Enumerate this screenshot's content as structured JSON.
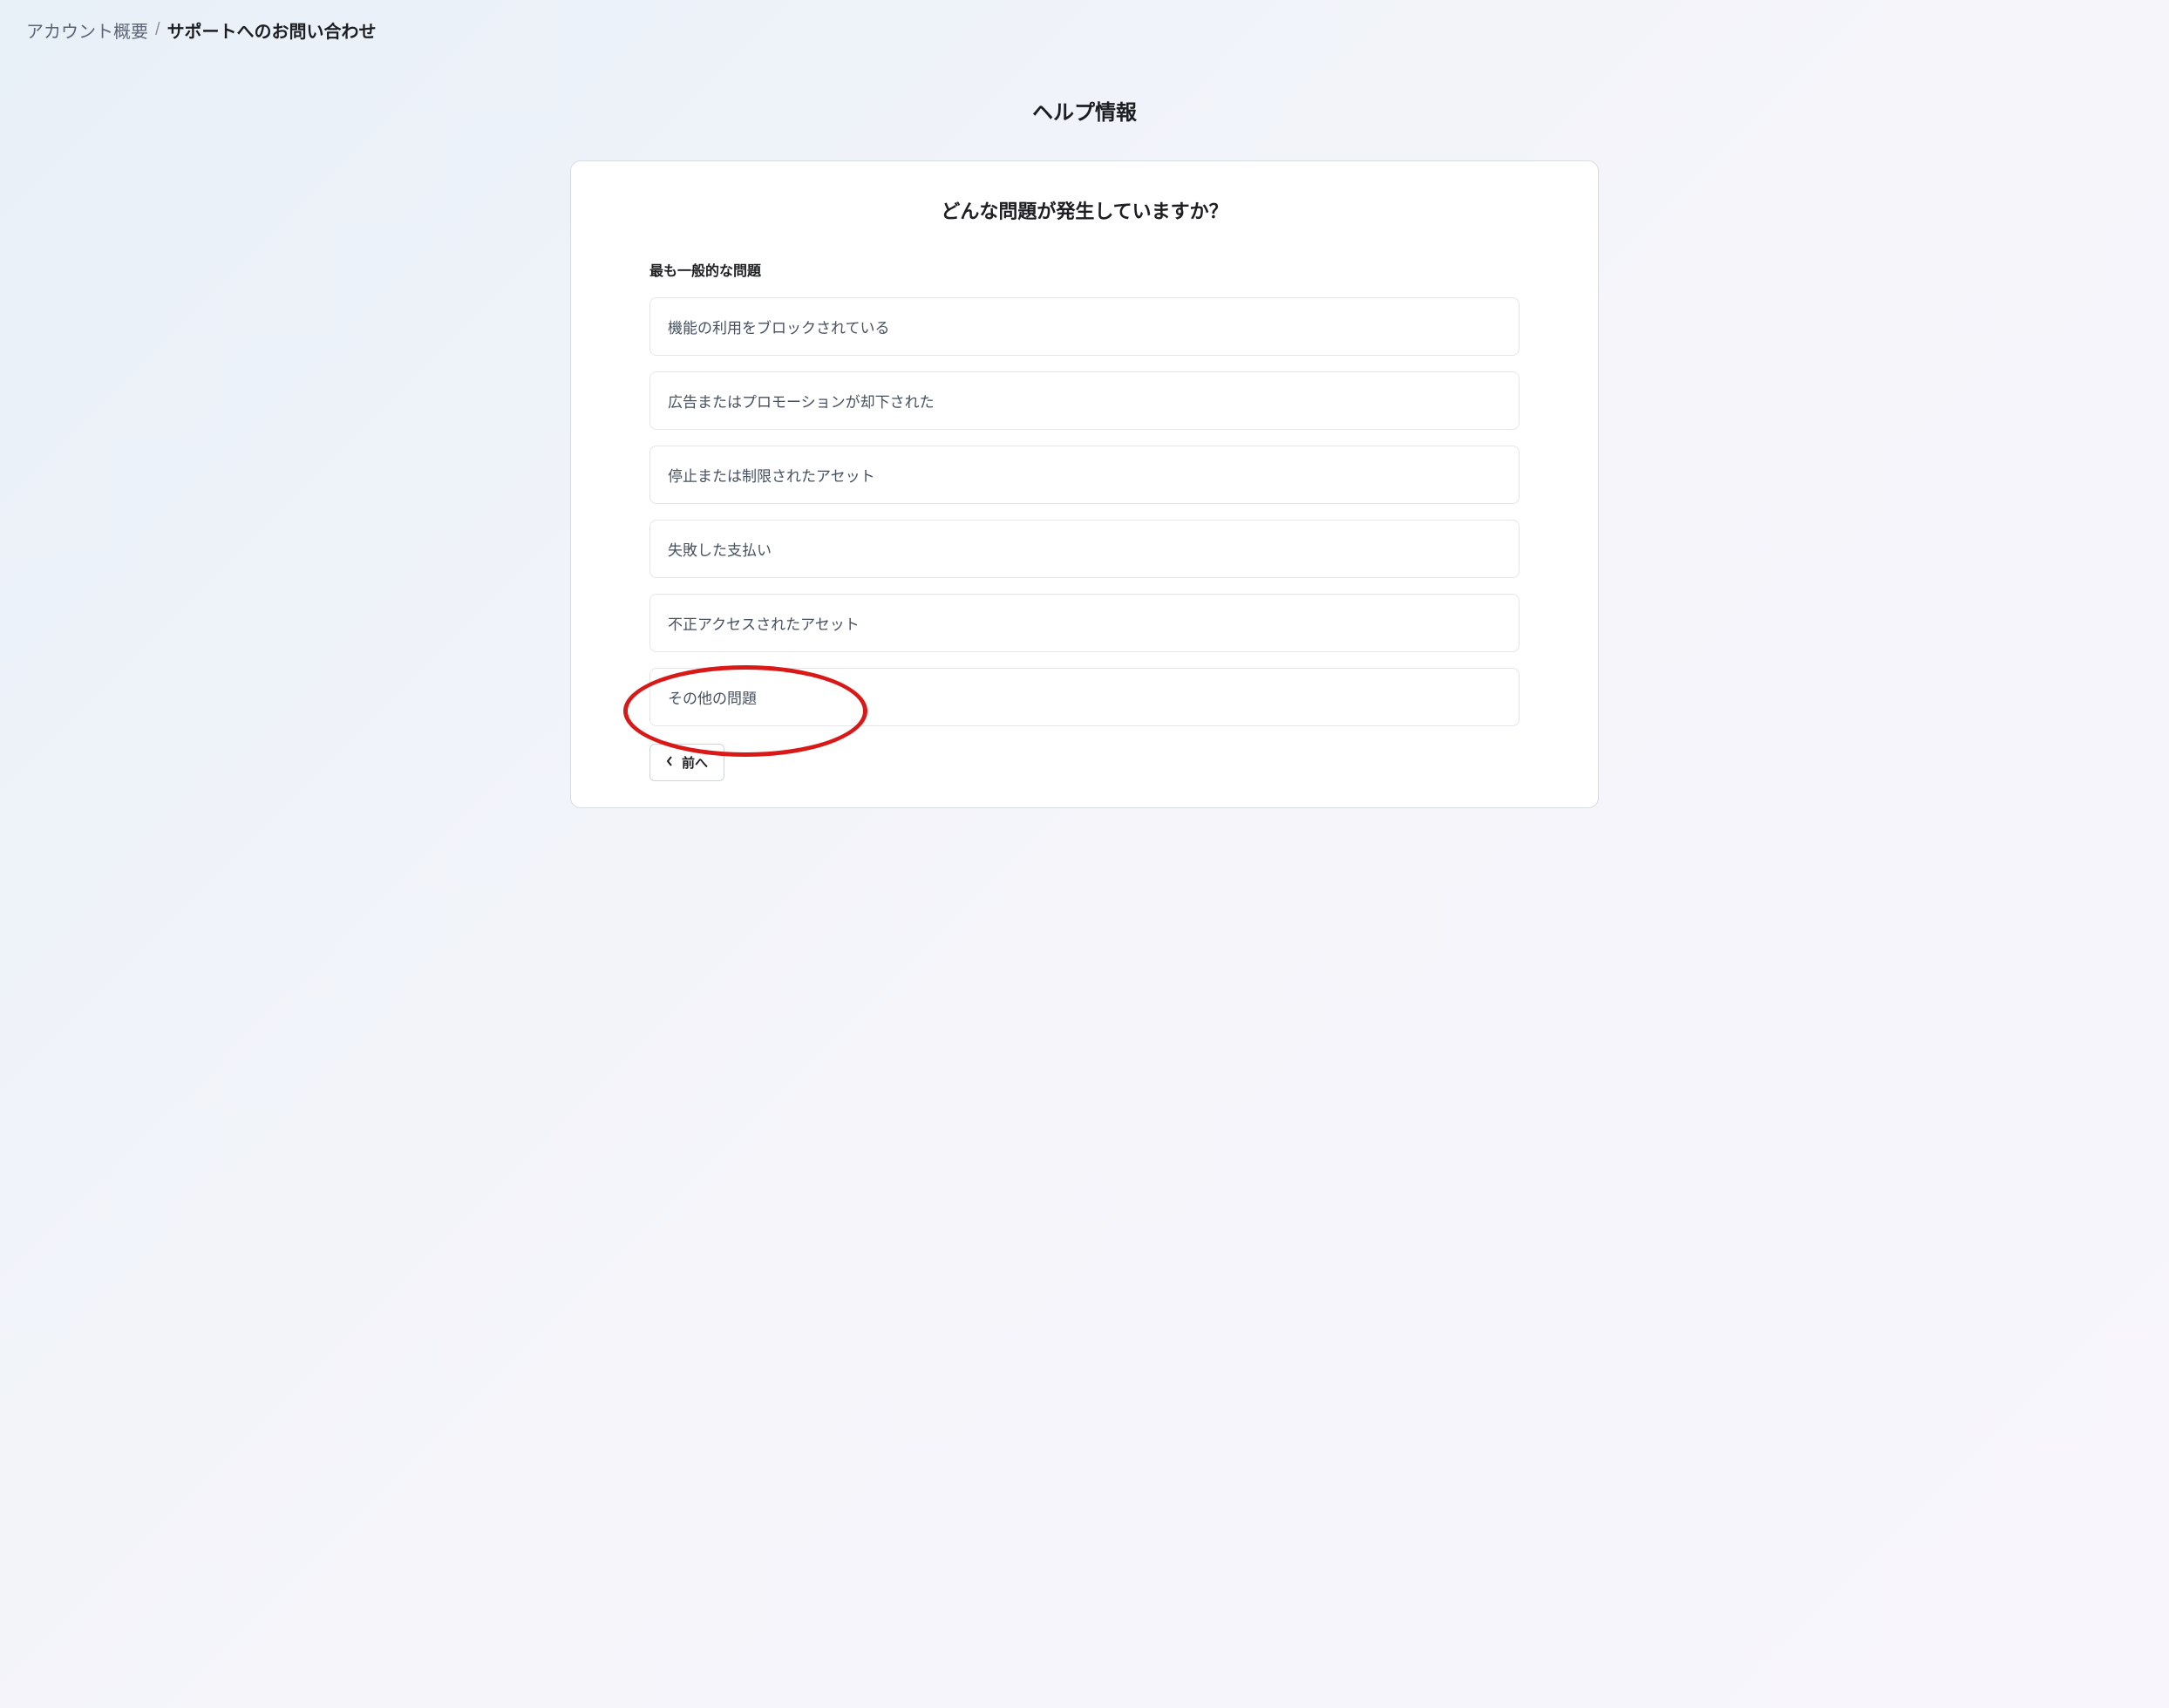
{
  "breadcrumb": {
    "link_label": "アカウント概要",
    "separator": "/",
    "current_label": "サポートへのお問い合わせ"
  },
  "page_title": "ヘルプ情報",
  "card": {
    "title": "どんな問題が発生していますか？",
    "section_label": "最も一般的な問題",
    "options": [
      "機能の利用をブロックされている",
      "広告またはプロモーションが却下された",
      "停止または制限されたアセット",
      "失敗した支払い",
      "不正アクセスされたアセット",
      "その他の問題"
    ],
    "prev_button_label": "前へ"
  }
}
